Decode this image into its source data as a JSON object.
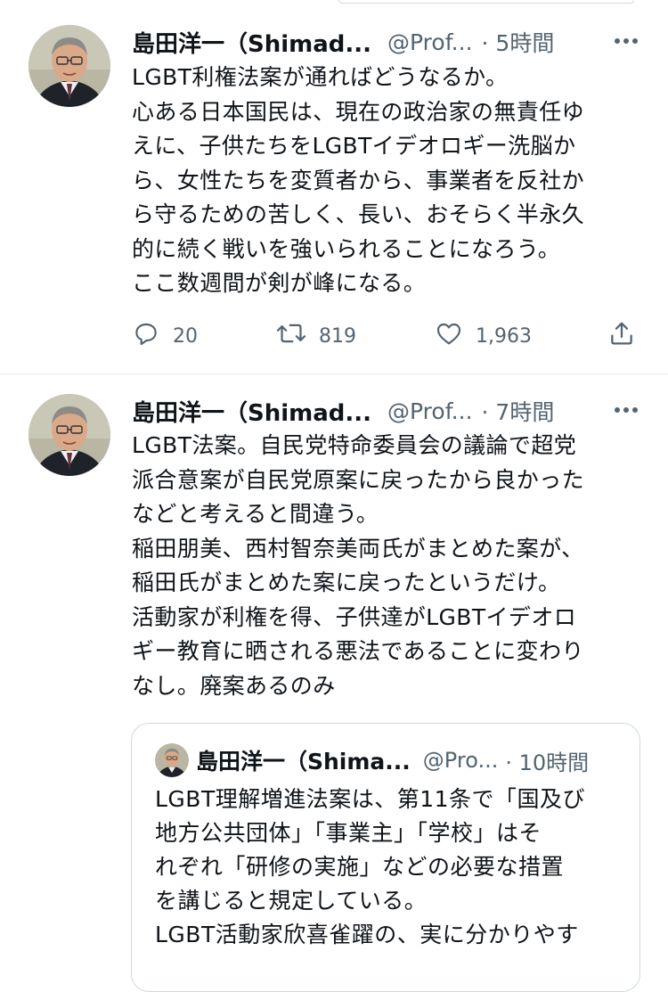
{
  "tweets": [
    {
      "author_name": "島田洋一（Shimad...",
      "handle": "@Prof...",
      "time": "· 5時間",
      "lines": [
        "LGBT利権法案が通ればどうなるか。",
        "心ある日本国民は、現在の政治家の無責任ゆ",
        "えに、子供たちをLGBTイデオロギー洗脳か",
        "ら、女性たちを変質者から、事業者を反社か",
        "ら守るための苦しく、長い、おそらく半永久",
        "的に続く戦いを強いられることになろう。",
        "ここ数週間が剣が峰になる。"
      ],
      "reply_count": "20",
      "retweet_count": "819",
      "like_count": "1,963"
    },
    {
      "author_name": "島田洋一（Shimad...",
      "handle": "@Prof...",
      "time": "· 7時間",
      "lines": [
        "LGBT法案。自民党特命委員会の議論で超党",
        "派合意案が自民党原案に戻ったから良かった",
        "などと考えると間違う。",
        "稲田朋美、西村智奈美両氏がまとめた案が、",
        "稲田氏がまとめた案に戻ったというだけ。",
        "活動家が利権を得、子供達がLGBTイデオロ",
        "ギー教育に晒される悪法であることに変わり",
        "なし。廃案あるのみ"
      ],
      "quote": {
        "author_name": "島田洋一（Shima...",
        "handle": "@Pro...",
        "time": "· 10時間",
        "lines": [
          "LGBT理解増進法案は、第11条で「国及び",
          "地方公共団体」「事業主」「学校」はそ",
          "れぞれ「研修の実施」などの必要な措置",
          "を講じると規定している。",
          "LGBT活動家欣喜雀躍の、実に分かりやす"
        ]
      }
    }
  ],
  "icons": {
    "more": "more-dots-icon",
    "reply": "reply-bubble-icon",
    "retweet": "retweet-icon",
    "like": "heart-icon",
    "share": "share-icon"
  },
  "colors": {
    "text": "#0f1419",
    "secondary": "#536471",
    "border": "#cfd9de"
  }
}
